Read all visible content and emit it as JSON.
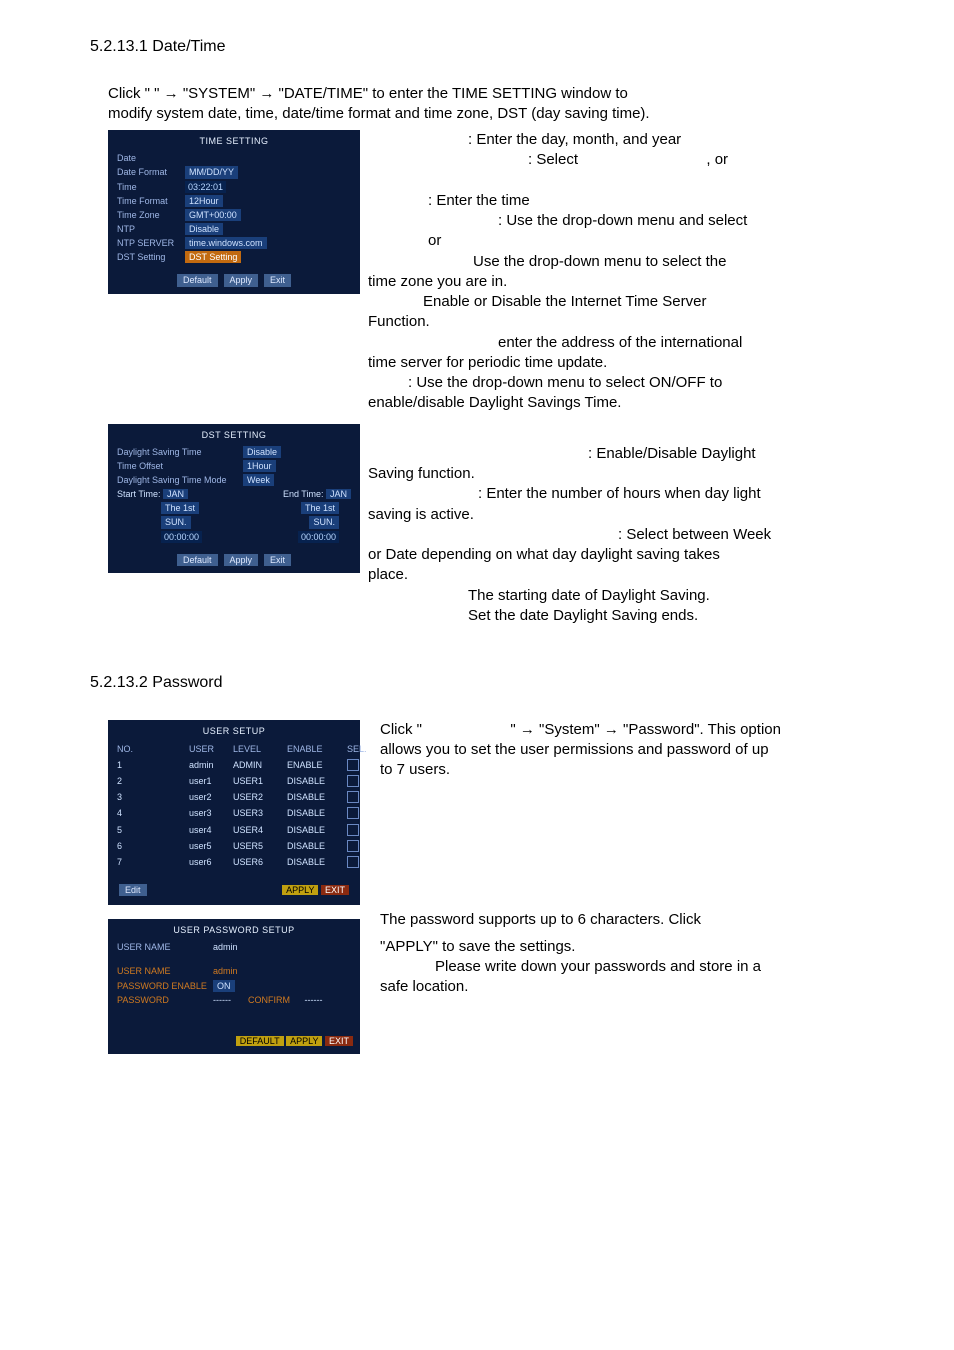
{
  "section1": {
    "heading": "5.2.13.1 Date/Time",
    "intro_prefix": "Click \"",
    "intro_mid1": "\" ",
    "intro_mid2": " \"SYSTEM\" ",
    "intro_mid3": " \"DATE/TIME\" to enter the TIME SETTING window to",
    "intro_line2": "modify system date, time, date/time format and time zone, DST (day saving time).",
    "arrow": "→"
  },
  "timeShot": {
    "title": "TIME SETTING",
    "rows": {
      "date_lbl": "Date",
      "date_val": "            ",
      "datefmt_lbl": "Date Format",
      "datefmt_val": "MM/DD/YY",
      "time_lbl": "Time",
      "time_val": "03:22:01",
      "timefmt_lbl": "Time Format",
      "timefmt_val": "12Hour",
      "tz_lbl": "Time Zone",
      "tz_val": "GMT+00:00",
      "ntp_lbl": "NTP",
      "ntp_val": "Disable",
      "ntps_lbl": "NTP SERVER",
      "ntps_val": "time.windows.com",
      "dst_lbl": "DST Setting",
      "dst_val": "DST Setting"
    },
    "btn_default": "Default",
    "btn_apply": "Apply",
    "btn_exit": "Exit"
  },
  "timeText": {
    "l1": ": Enter the day, month, and year",
    "l2a": ": Select",
    "l2b": ", or",
    "l3": ": Enter the time",
    "l4": ": Use the drop-down menu and select",
    "l5": "or",
    "l6": "Use the drop-down menu to select the",
    "l7": "time zone you are in.",
    "l8": "Enable or Disable the Internet Time Server",
    "l9": "Function.",
    "l10": "enter the address of the international",
    "l11": "time server for periodic time update.",
    "l12": ": Use the drop-down menu to select ON/OFF to",
    "l13": "enable/disable Daylight Savings Time."
  },
  "dstShot": {
    "title": "DST SETTING",
    "r1_lbl": "Daylight Saving Time",
    "r1_val": "Disable",
    "r2_lbl": "Time Offset",
    "r2_val": "1Hour",
    "r3_lbl": "Daylight Saving Time Mode",
    "r3_val": "Week",
    "start_lbl": "Start Time:",
    "end_lbl": "End Time:",
    "mon": "JAN",
    "the": "The 1st",
    "sun": "SUN.",
    "t1": "00:00:00",
    "btn_default": "Default",
    "btn_apply": "Apply",
    "btn_exit": "Exit"
  },
  "dstText": {
    "l1": ": Enable/Disable Daylight",
    "l2": "Saving function.",
    "l3": ": Enter the number of hours when day light",
    "l4": "saving is active.",
    "l5": ": Select between Week",
    "l6": "or Date depending on what day daylight saving takes",
    "l7": "place.",
    "l8": "The starting date of Daylight Saving.",
    "l9": "Set the date Daylight Saving ends."
  },
  "section2": {
    "heading": "5.2.13.2 Password"
  },
  "userShot": {
    "title": "USER SETUP",
    "hdr_no": "NO.",
    "hdr_user": "USER",
    "hdr_level": "LEVEL",
    "hdr_enable": "ENABLE",
    "hdr_sel": "SEL.",
    "rows": [
      {
        "no": "1",
        "user": "admin",
        "level": "ADMIN",
        "enable": "ENABLE"
      },
      {
        "no": "2",
        "user": "user1",
        "level": "USER1",
        "enable": "DISABLE"
      },
      {
        "no": "3",
        "user": "user2",
        "level": "USER2",
        "enable": "DISABLE"
      },
      {
        "no": "4",
        "user": "user3",
        "level": "USER3",
        "enable": "DISABLE"
      },
      {
        "no": "5",
        "user": "user4",
        "level": "USER4",
        "enable": "DISABLE"
      },
      {
        "no": "6",
        "user": "user5",
        "level": "USER5",
        "enable": "DISABLE"
      },
      {
        "no": "7",
        "user": "user6",
        "level": "USER6",
        "enable": "DISABLE"
      }
    ],
    "edit": "Edit",
    "apply": "APPLY",
    "exit": "EXIT"
  },
  "userText": {
    "l1a": "Click \"",
    "l1b": "\" ",
    "l1c": " \"System\" ",
    "l1d": " \"Password\". This option",
    "l2": "allows you to set the user permissions and password of up",
    "l3": "to 7 users."
  },
  "pwShot": {
    "title": "USER PASSWORD SETUP",
    "un_lbl": "USER NAME",
    "un_val": "admin",
    "un2_lbl": "USER NAME",
    "un2_val": "admin",
    "pe_lbl": "PASSWORD ENABLE",
    "pe_val": "ON",
    "pw_lbl": "PASSWORD",
    "conf": "CONFIRM",
    "default": "DEFAULT",
    "apply": "APPLY",
    "exit": "EXIT"
  },
  "pwText": {
    "l1": "The password supports up to 6 characters.    Click",
    "l2": "\"APPLY\" to save the settings.",
    "l3": "Please write down your passwords and store in a",
    "l4": "safe location."
  }
}
